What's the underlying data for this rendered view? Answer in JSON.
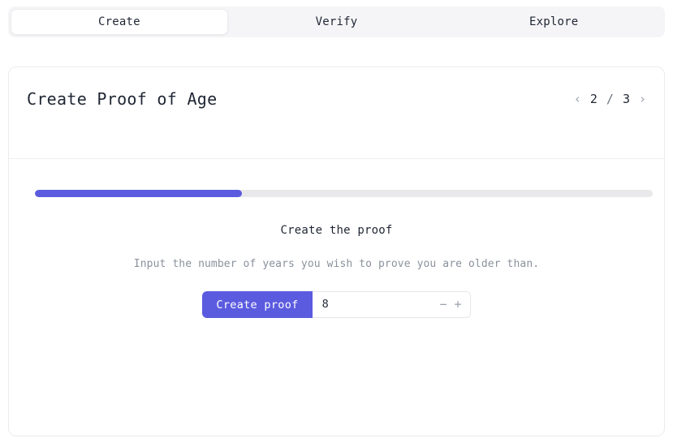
{
  "tabs": [
    {
      "label": "Create",
      "active": true
    },
    {
      "label": "Verify",
      "active": false
    },
    {
      "label": "Explore",
      "active": false
    }
  ],
  "card": {
    "title": "Create Proof of Age",
    "pagination": {
      "prev_icon": "‹",
      "current": "2",
      "separator": "/",
      "total": "3",
      "next_icon": "›"
    },
    "progress": {
      "percent": 33.5,
      "fill_color": "#5b5be0",
      "track_color": "#e9e9eb"
    }
  },
  "body": {
    "step_title": "Create the proof",
    "step_description": "Input the number of years you wish to prove you are older than.",
    "create_button_label": "Create proof",
    "years_value": "8",
    "years_placeholder": "8",
    "decrement_icon": "−",
    "increment_icon": "+"
  },
  "colors": {
    "accent": "#5b5be0",
    "tabbar_bg": "#f5f5f7",
    "card_border": "#ececee",
    "muted_text": "#8b919c",
    "dark_text": "#1f2633"
  }
}
